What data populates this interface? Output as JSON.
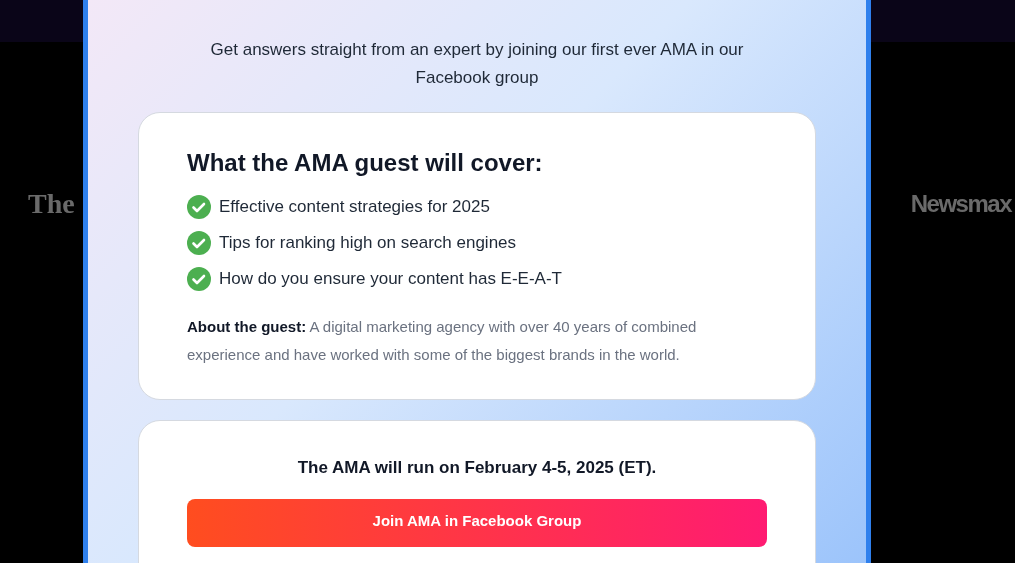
{
  "background_logos": [
    "The",
    "Newsmax"
  ],
  "modal": {
    "subtitle": "Get answers straight from an expert by joining our first ever AMA in our Facebook group",
    "topics_card": {
      "heading": "What the AMA guest will cover:",
      "items": [
        "Effective content strategies for 2025",
        "Tips for ranking high on search engines",
        "How do you ensure your content has E-E-A-T"
      ],
      "about": "**About the guest:** A digital marketing agency with over 40 years of combined experience and have worked with some of the biggest brands in the world."
    },
    "schedule_card": {
      "text": "The AMA will run on February 4-5, 2025 (ET).",
      "button": "Join AMA in Facebook Group"
    }
  }
}
